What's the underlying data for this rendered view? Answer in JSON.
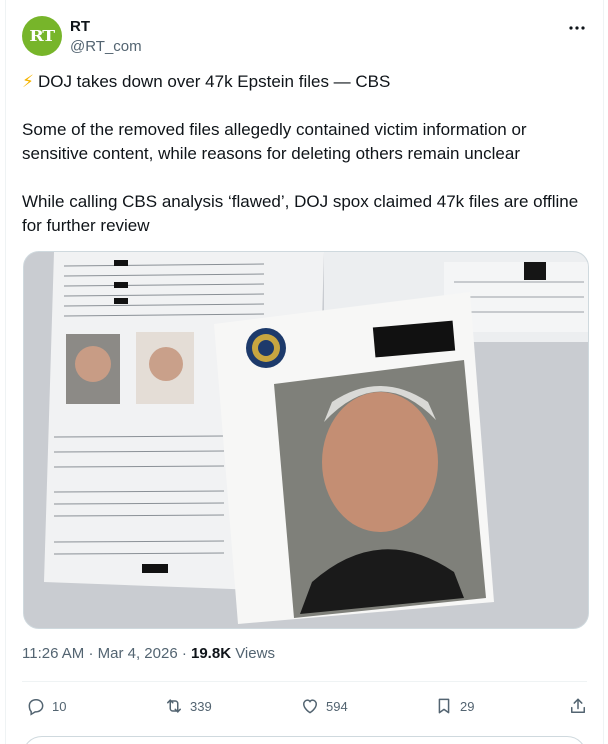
{
  "author": {
    "avatar_text": "RT",
    "name": "RT",
    "handle": "@RT_com"
  },
  "post": {
    "headline": "DOJ takes down over 47k Epstein files — CBS",
    "headline_emoji": "⚡",
    "paragraph_1": "Some of the removed files allegedly contained victim information or sensitive content, while reasons for deleting others remain unclear",
    "paragraph_2": "While calling CBS analysis ‘flawed’, DOJ spox claimed 47k files are offline for further review"
  },
  "meta": {
    "time": "11:26 AM",
    "date": "Mar 4, 2026",
    "views_count": "19.8K",
    "views_label": "Views"
  },
  "actions": {
    "replies": "10",
    "reposts": "339",
    "likes": "594",
    "bookmarks": "29"
  },
  "colors": {
    "avatar_bg": "#77b52a",
    "text": "#0f1419",
    "secondary_text": "#536471",
    "border": "#eff3f4"
  }
}
